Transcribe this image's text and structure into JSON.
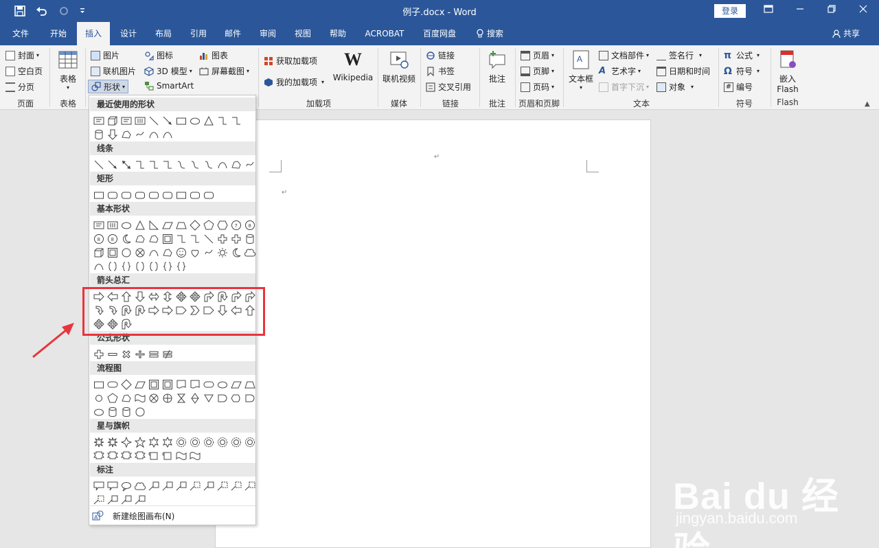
{
  "titlebar": {
    "title": "例子.docx  -  Word",
    "login_label": "登录",
    "qa_icons": [
      "save-icon",
      "undo-icon",
      "redo-icon",
      "customize-icon"
    ],
    "win_icons": [
      "ribbon-display-icon",
      "minimize-icon",
      "restore-icon",
      "close-icon"
    ]
  },
  "tabs": {
    "items": [
      "文件",
      "开始",
      "插入",
      "设计",
      "布局",
      "引用",
      "邮件",
      "审阅",
      "视图",
      "帮助",
      "ACROBAT",
      "百度网盘",
      "搜索"
    ],
    "active": "插入",
    "share_label": "共享"
  },
  "ribbon": {
    "page": {
      "cover": "封面",
      "blank": "空白页",
      "break": "分页",
      "label": "页面"
    },
    "table": {
      "table": "表格",
      "label": "表格"
    },
    "illustrations": {
      "picture": "图片",
      "online_picture": "联机图片",
      "shapes": "形状",
      "icons": "图标",
      "model3d": "3D 模型",
      "smartart": "SmartArt",
      "chart": "图表",
      "screenshot": "屏幕截图"
    },
    "addins": {
      "get": "获取加载项",
      "my": "我的加载项",
      "wikipedia": "Wikipedia",
      "label": "加载项"
    },
    "media": {
      "online_video": "联机视频",
      "label": "媒体"
    },
    "links": {
      "link": "链接",
      "bookmark": "书签",
      "cross_ref": "交叉引用",
      "label": "链接"
    },
    "comments": {
      "comment": "批注",
      "label": "批注"
    },
    "header_footer": {
      "header": "页眉",
      "footer": "页脚",
      "page_number": "页码",
      "label": "页眉和页脚"
    },
    "text": {
      "textbox": "文本框",
      "quick_parts": "文档部件",
      "wordart": "艺术字",
      "drop_cap": "首字下沉",
      "signature": "签名行",
      "date_time": "日期和时间",
      "object": "对象",
      "label": "文本"
    },
    "symbols": {
      "equation": "公式",
      "symbol": "符号",
      "number": "编号",
      "label": "符号"
    },
    "flash": {
      "embed_1": "嵌入",
      "embed_2": "Flash",
      "label": "Flash"
    }
  },
  "gallery": {
    "categories": [
      "最近使用的形状",
      "线条",
      "矩形",
      "基本形状",
      "箭头总汇",
      "公式形状",
      "流程图",
      "星与旗帜",
      "标注"
    ],
    "new_canvas": "新建绘图画布(N)"
  },
  "watermark": {
    "main": "Bai du 经验",
    "url": "jingyan.baidu.com"
  },
  "colors": {
    "accent": "#2b579a",
    "highlight": "#e8343c"
  }
}
